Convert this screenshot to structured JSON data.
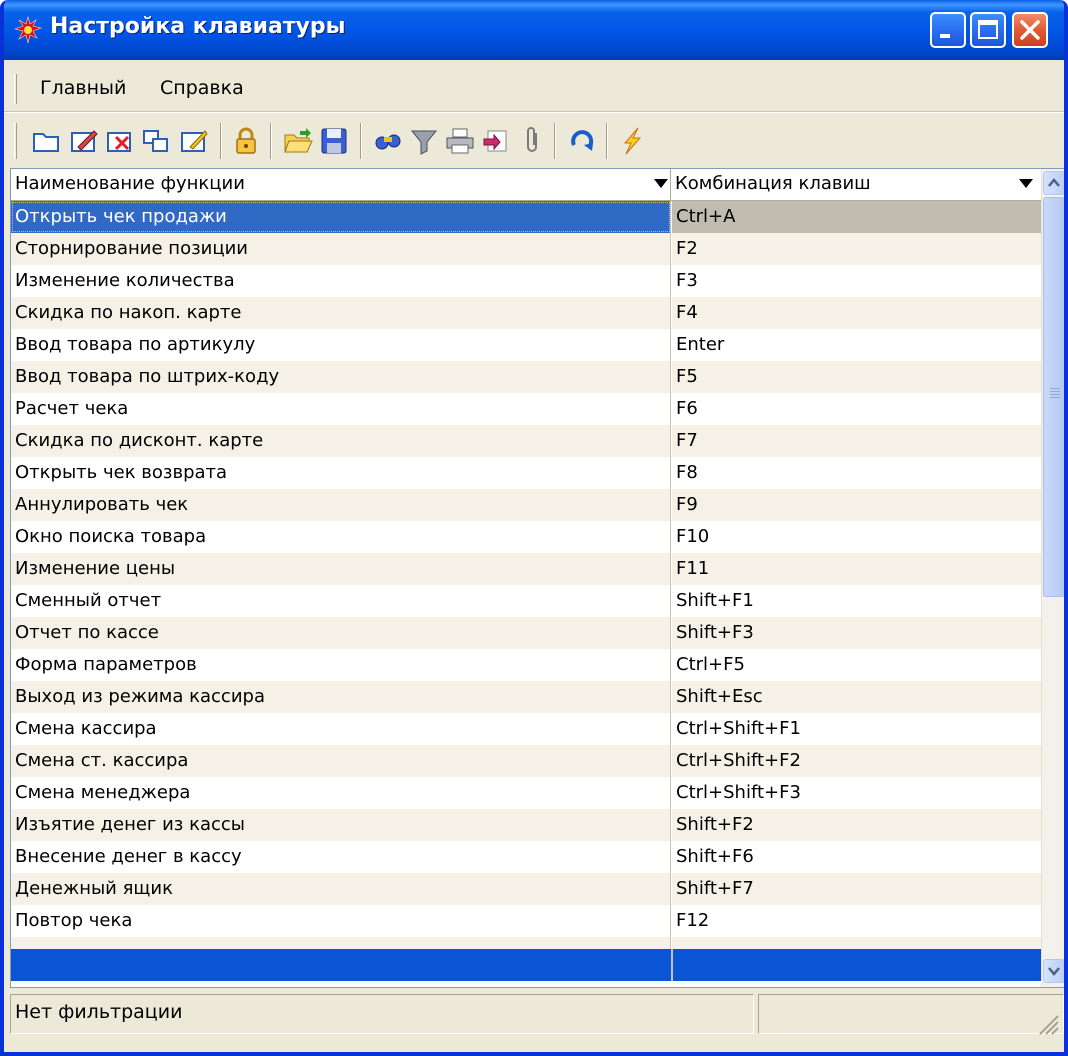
{
  "window": {
    "title": "Настройка клавиатуры",
    "icon": "red-gear-icon"
  },
  "menu": {
    "items": [
      "Главный",
      "Справка"
    ]
  },
  "toolbar": {
    "icons": [
      "new-folder-icon",
      "edit-icon",
      "delete-icon",
      "copy-icon",
      "edit-lightning-icon",
      "lock-icon",
      "open-folder-icon",
      "save-icon",
      "search-binoculars-icon",
      "filter-icon",
      "print-icon",
      "export-icon",
      "attach-paperclip-icon",
      "refresh-icon",
      "lightning-icon"
    ]
  },
  "grid": {
    "columns": [
      "Наименование функции",
      "Комбинация клавиш"
    ],
    "rows": [
      [
        "Открыть чек продажи",
        "Ctrl+A"
      ],
      [
        "Сторнирование позиции",
        "F2"
      ],
      [
        "Изменение количества",
        "F3"
      ],
      [
        "Скидка по накоп. карте",
        "F4"
      ],
      [
        "Ввод товара по артикулу",
        "Enter"
      ],
      [
        "Ввод товара по штрих-коду",
        "F5"
      ],
      [
        "Расчет чека",
        "F6"
      ],
      [
        "Скидка по дисконт. карте",
        "F7"
      ],
      [
        "Открыть чек возврата",
        "F8"
      ],
      [
        "Аннулировать чек",
        "F9"
      ],
      [
        "Окно поиска товара",
        "F10"
      ],
      [
        "Изменение цены",
        "F11"
      ],
      [
        "Сменный отчет",
        "Shift+F1"
      ],
      [
        "Отчет по кассе",
        "Shift+F3"
      ],
      [
        "Форма параметров",
        "Ctrl+F5"
      ],
      [
        "Выход из режима кассира",
        "Shift+Esc"
      ],
      [
        "Смена кассира",
        "Ctrl+Shift+F1"
      ],
      [
        "Смена ст. кассира",
        "Ctrl+Shift+F2"
      ],
      [
        "Смена менеджера",
        "Ctrl+Shift+F3"
      ],
      [
        "Изъятие денег из кассы",
        "Shift+F2"
      ],
      [
        "Внесение денег в кассу",
        "Shift+F6"
      ],
      [
        "Денежный ящик",
        "Shift+F7"
      ],
      [
        "Повтор чека",
        "F12"
      ]
    ],
    "selected_row": 0
  },
  "status": {
    "filter_text": "Нет фильтрации"
  },
  "colors": {
    "title_blue": "#0055e5",
    "selection": "#316ac5",
    "window_bg": "#ece9d8"
  }
}
